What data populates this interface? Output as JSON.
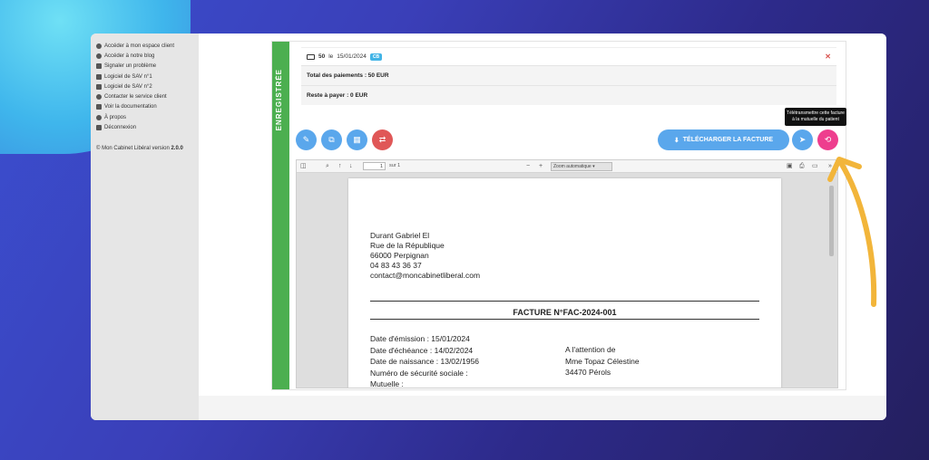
{
  "sidebar": {
    "items": [
      {
        "label": "Accéder à mon espace client",
        "icon": "user-icon"
      },
      {
        "label": "Accéder à notre blog",
        "icon": "trophy-icon"
      },
      {
        "label": "Signaler un problème",
        "icon": "bug-icon"
      },
      {
        "label": "Logiciel de SAV n°1",
        "icon": "book-icon"
      },
      {
        "label": "Logiciel de SAV n°2",
        "icon": "book-icon"
      },
      {
        "label": "Contacter le service client",
        "icon": "headset-icon"
      },
      {
        "label": "Voir la documentation",
        "icon": "book-icon"
      },
      {
        "label": "À propos",
        "icon": "info-icon"
      },
      {
        "label": "Déconnexion",
        "icon": "logout-icon"
      }
    ],
    "version_prefix": "© Mon Cabinet Libéral version",
    "version": "2.0.0"
  },
  "invoice_card": {
    "status": "ENREGISTRÉE",
    "payment": {
      "amount": "50",
      "date_prefix": "le",
      "date": "15/01/2024",
      "method": "CB"
    },
    "total_paid": "Total des paiements : 50 EUR",
    "remaining": "Reste à payer : 0 EUR",
    "download_label": "TÉLÉCHARGER LA FACTURE",
    "tooltip": "Télétransmettre cette facture à la mutuelle du patient"
  },
  "viewer": {
    "page": "1",
    "page_of": "sur 1",
    "zoom": "Zoom automatique"
  },
  "document": {
    "sender": {
      "name": "Durant Gabriel El",
      "street": "Rue de la République",
      "city": "66000 Perpignan",
      "phone": "04 83 43 36 37",
      "email": "contact@moncabinetliberal.com"
    },
    "title": "FACTURE N°FAC-2024-001",
    "emission": "Date d'émission : 15/01/2024",
    "due": "Date d'échéance : 14/02/2024",
    "birth": "Date de naissance : 13/02/1956",
    "ssn": "Numéro de sécurité sociale :",
    "mutuelle": "Mutuelle :",
    "attention": "A l'attention de",
    "recipient_name": "Mme Topaz Célestine",
    "recipient_city": "34470 Pérols"
  },
  "colors": {
    "status_green": "#4caf50",
    "button_blue": "#5aa7ec",
    "button_red": "#e05757",
    "button_pink": "#ee3e8e",
    "arrow_yellow": "#f2b53a"
  }
}
